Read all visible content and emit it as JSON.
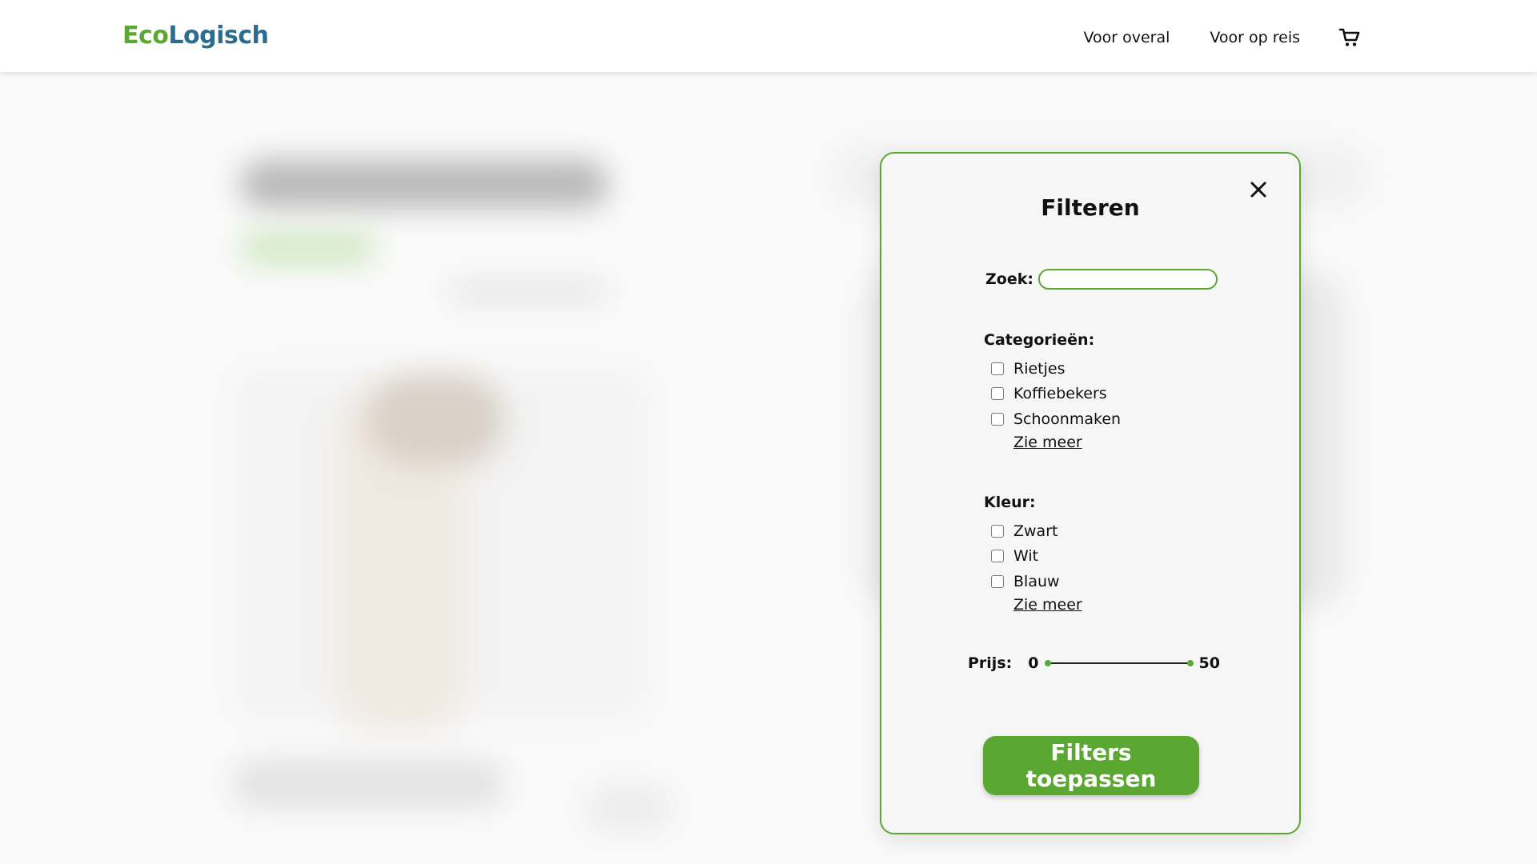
{
  "brand": {
    "part1": "Eco",
    "part2": "Logisch"
  },
  "nav": {
    "items": [
      "Voor overal",
      "Voor op reis"
    ]
  },
  "filter": {
    "title": "Filteren",
    "search_label": "Zoek:",
    "search_value": "",
    "categories": {
      "title": "Categorieën:",
      "options": [
        "Rietjes",
        "Koffiebekers",
        "Schoonmaken"
      ],
      "more": "Zie meer"
    },
    "colors": {
      "title": "Kleur:",
      "options": [
        "Zwart",
        "Wit",
        "Blauw"
      ],
      "more": "Zie meer"
    },
    "price": {
      "label": "Prijs:",
      "min": "0",
      "max": "50"
    },
    "apply_label": "Filters toepassen"
  },
  "colors": {
    "accent": "#5aa832",
    "brand_blue": "#2c6c8f"
  },
  "icons": {
    "cart": "cart-icon",
    "close": "close-icon"
  }
}
